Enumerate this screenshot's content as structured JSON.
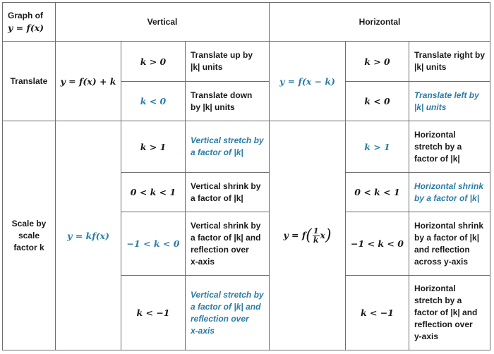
{
  "colors": {
    "accent_blue": "#2a7ca8",
    "text": "#1a1a1a",
    "border": "#6e6e6e"
  },
  "header": {
    "corner_line1": "Graph of",
    "corner_line2": "y = f(x)",
    "vertical": "Vertical",
    "horizontal": "Horizontal"
  },
  "translate": {
    "label": "Translate",
    "vertical_formula": "y = f(x) + k",
    "horizontal_formula": "y = f(x − k)",
    "vertical_rows": [
      {
        "condition": "k > 0",
        "desc_line1": "Translate up by",
        "desc_line2": "|k| units"
      },
      {
        "condition": "k < 0",
        "desc_line1": "Translate down",
        "desc_line2": "by |k| units"
      }
    ],
    "horizontal_rows": [
      {
        "condition": "k > 0",
        "desc_line1": "Translate right by",
        "desc_line2": "|k| units"
      },
      {
        "condition": "k < 0",
        "desc_line1": "Translate left by",
        "desc_line2": "|k| units"
      }
    ]
  },
  "scale": {
    "label_line1": "Scale by",
    "label_line2": "scale",
    "label_line3": "factor k",
    "vertical_formula": "y = kf(x)",
    "horizontal_formula_prefix": "y = f",
    "horizontal_formula_num": "1",
    "horizontal_formula_den": "k",
    "horizontal_formula_var": "x",
    "vertical_rows": [
      {
        "condition": "k > 1",
        "lines": [
          "Vertical stretch by",
          "a factor of |k|"
        ]
      },
      {
        "condition": "0 < k < 1",
        "lines": [
          "Vertical shrink by",
          "a factor of |k|"
        ]
      },
      {
        "condition": "−1 < k < 0",
        "lines": [
          "Vertical shrink by",
          "a factor of |k| and",
          "reflection over",
          "x-axis"
        ]
      },
      {
        "condition": "k < −1",
        "lines": [
          "Vertical stretch by",
          "a factor of |k| and",
          "reflection over",
          "x-axis"
        ]
      }
    ],
    "horizontal_rows": [
      {
        "condition": "k > 1",
        "lines": [
          "Horizontal",
          "stretch by a",
          "factor of |k|"
        ]
      },
      {
        "condition": "0 < k < 1",
        "lines": [
          "Horizontal shrink",
          "by a factor of |k|"
        ]
      },
      {
        "condition": "−1 < k < 0",
        "lines": [
          "Horizontal shrink",
          "by a factor of |k|",
          "and reflection",
          "across y-axis"
        ]
      },
      {
        "condition": "k < −1",
        "lines": [
          "Horizontal",
          "stretch by a",
          "factor of |k| and",
          "reflection over",
          "y-axis"
        ]
      }
    ]
  }
}
